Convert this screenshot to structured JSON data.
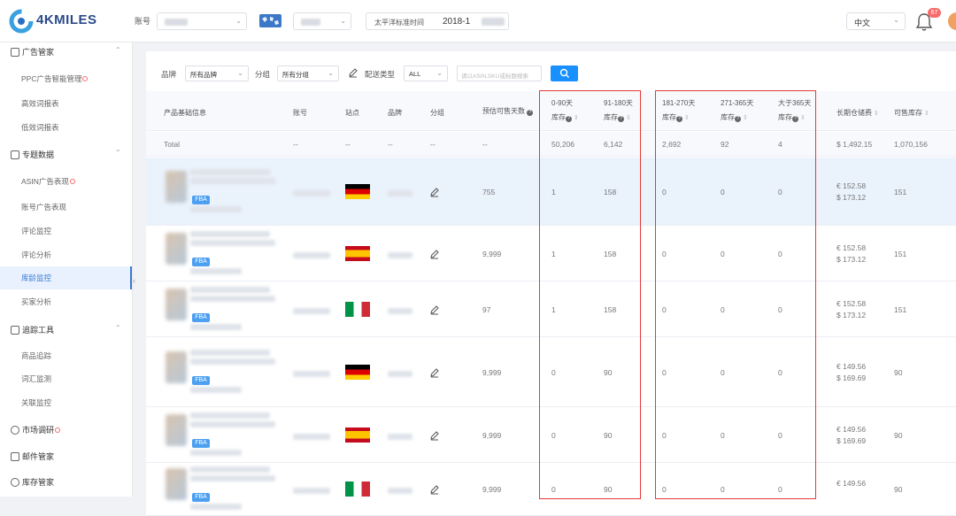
{
  "app": {
    "logo_text": "4KMILES"
  },
  "topbar": {
    "account_label": "账号",
    "time_label": "太平洋标准时间",
    "time_value": "2018-1",
    "language": "中文",
    "notification_count": "67"
  },
  "sidebar": {
    "groups": [
      {
        "label": "广告管家",
        "items": [
          {
            "label": "PPC广告智能管理",
            "dot": true
          },
          {
            "label": "高效词报表"
          },
          {
            "label": "低效词报表"
          }
        ]
      },
      {
        "label": "专题数据",
        "items": [
          {
            "label": "ASIN广告表现",
            "dot": true
          },
          {
            "label": "账号广告表现"
          },
          {
            "label": "评论监控"
          },
          {
            "label": "评论分析"
          },
          {
            "label": "库龄监控",
            "active": true
          },
          {
            "label": "买家分析"
          }
        ]
      },
      {
        "label": "追踪工具",
        "items": [
          {
            "label": "商品追踪"
          },
          {
            "label": "词汇监测"
          },
          {
            "label": "关联监控"
          }
        ]
      },
      {
        "label": "市场调研",
        "dot": true
      },
      {
        "label": "邮件管家"
      },
      {
        "label": "库存管家"
      }
    ]
  },
  "filters": {
    "brand_label": "品牌",
    "brand_value": "所有品牌",
    "group_label": "分组",
    "group_value": "所有分组",
    "fulfillment_label": "配送类型",
    "fulfillment_value": "ALL",
    "search_placeholder": "请以ASIN,SKU或标题搜索"
  },
  "table": {
    "headers": {
      "product": "产品基础信息",
      "account": "账号",
      "site": "站点",
      "brand": "品牌",
      "group": "分组",
      "days": "预估可售天数",
      "b1_top": "0-90天",
      "b1_bot": "库存",
      "b2_top": "91-180天",
      "b2_bot": "库存",
      "b3_top": "181-270天",
      "b3_bot": "库存",
      "b4_top": "271-365天",
      "b4_bot": "库存",
      "b5_top": "大于365天",
      "b5_bot": "库存",
      "storage": "长期仓储费",
      "sellable": "可售库存"
    },
    "total": {
      "label": "Total",
      "account": "--",
      "site": "--",
      "brand": "--",
      "group": "--",
      "days": "--",
      "b1": "50,206",
      "b2": "6,142",
      "b3": "2,692",
      "b4": "92",
      "b5": "4",
      "storage": "$ 1,492.15",
      "sellable": "1,070,156"
    },
    "rows": [
      {
        "flag": "de",
        "days": "755",
        "b1": "1",
        "b2": "158",
        "b3": "0",
        "b4": "0",
        "b5": "0",
        "fee1": "€ 152.58",
        "fee2": "$ 173.12",
        "sellable": "151",
        "highlight": true
      },
      {
        "flag": "es",
        "days": "9,999",
        "b1": "1",
        "b2": "158",
        "b3": "0",
        "b4": "0",
        "b5": "0",
        "fee1": "€ 152.58",
        "fee2": "$ 173.12",
        "sellable": "151"
      },
      {
        "flag": "it",
        "days": "97",
        "b1": "1",
        "b2": "158",
        "b3": "0",
        "b4": "0",
        "b5": "0",
        "fee1": "€ 152.58",
        "fee2": "$ 173.12",
        "sellable": "151"
      },
      {
        "flag": "de",
        "days": "9,999",
        "b1": "0",
        "b2": "90",
        "b3": "0",
        "b4": "0",
        "b5": "0",
        "fee1": "€ 149.56",
        "fee2": "$ 169.69",
        "sellable": "90"
      },
      {
        "flag": "es",
        "days": "9,999",
        "b1": "0",
        "b2": "90",
        "b3": "0",
        "b4": "0",
        "b5": "0",
        "fee1": "€ 149.56",
        "fee2": "$ 169.69",
        "sellable": "90"
      },
      {
        "flag": "it",
        "days": "9,999",
        "b1": "0",
        "b2": "90",
        "b3": "0",
        "b4": "0",
        "b5": "0",
        "fee1": "€ 149.56",
        "fee2": "",
        "sellable": "90"
      }
    ],
    "fba_tag": "FBA"
  }
}
